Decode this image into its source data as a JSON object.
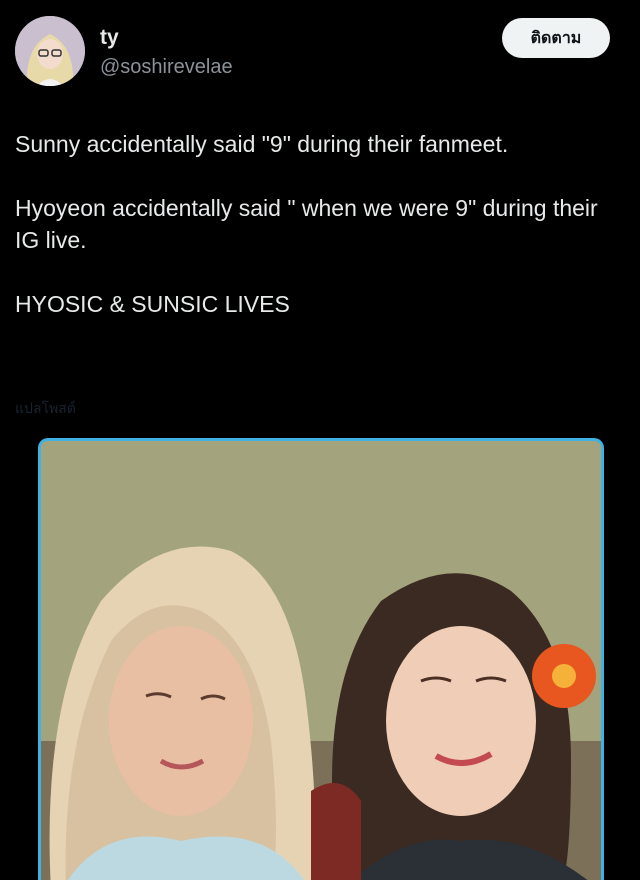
{
  "author": {
    "display_name": "ty",
    "handle": "@soshirevelae",
    "avatar_icon": "profile-avatar"
  },
  "follow_button": {
    "label": "ติดตาม"
  },
  "tweet": {
    "paragraphs": [
      "Sunny accidentally said \"9\" during their fanmeet.",
      "Hyoyeon accidentally said \" when we were 9\" during their IG live.",
      "HYOSIC & SUNSIC LIVES"
    ],
    "translate_link": "แปลโพสต์"
  },
  "media": {
    "border_color": "#3fb2e3",
    "description_icon": "photo-thumbnail"
  },
  "colors": {
    "background": "#000000",
    "text_primary": "#e7e9ea",
    "text_secondary": "#8b9299",
    "button_bg": "#eff3f4"
  }
}
